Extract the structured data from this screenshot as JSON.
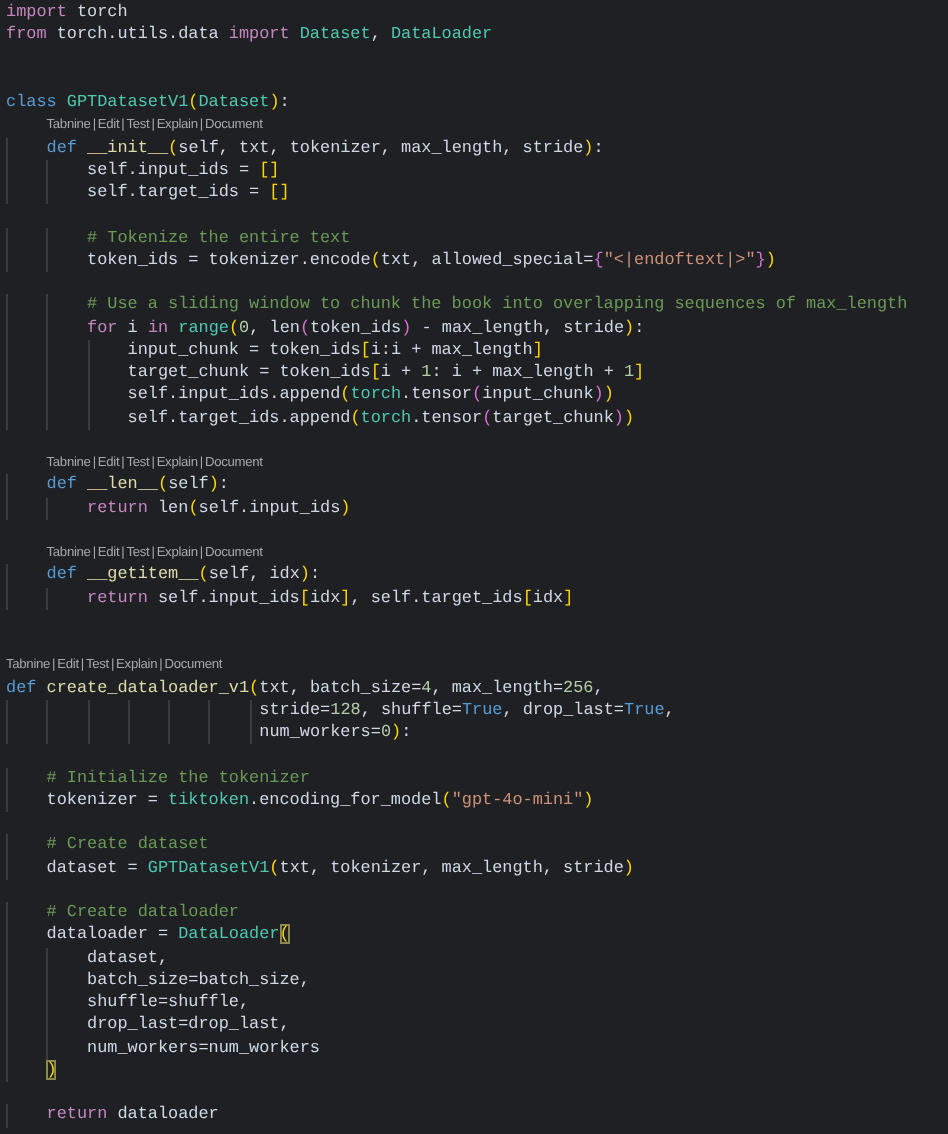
{
  "editor": {
    "lens_separator": "|",
    "lines": [
      {
        "kind": "code",
        "tokens": [
          {
            "kind": "keyword",
            "text": "import"
          },
          {
            "kind": "plain",
            "text": " torch"
          }
        ]
      },
      {
        "kind": "code",
        "tokens": [
          {
            "kind": "keyword",
            "text": "from"
          },
          {
            "kind": "plain",
            "text": " torch.utils.data "
          },
          {
            "kind": "keyword",
            "text": "import"
          },
          {
            "kind": "class",
            "text": " Dataset"
          },
          {
            "kind": "plain",
            "text": ", "
          },
          {
            "kind": "class",
            "text": "DataLoader"
          }
        ]
      },
      {
        "kind": "blank"
      },
      {
        "kind": "blank"
      },
      {
        "kind": "code",
        "tokens": [
          {
            "kind": "storage",
            "text": "class"
          },
          {
            "kind": "class",
            "text": " GPTDatasetV1"
          },
          {
            "kind": "bracket",
            "text": "("
          },
          {
            "kind": "class",
            "text": "Dataset"
          },
          {
            "kind": "bracket",
            "text": ")"
          },
          {
            "kind": "plain",
            "text": ":"
          }
        ]
      },
      {
        "kind": "lens",
        "items": [
          "Tabnine",
          "Edit",
          "Test",
          "Explain",
          "Document"
        ]
      },
      {
        "kind": "code",
        "tokens": [
          {
            "kind": "storage",
            "text": "    def"
          },
          {
            "kind": "function",
            "text": " __init__"
          },
          {
            "kind": "bracket",
            "text": "("
          },
          {
            "kind": "plain",
            "text": "self, txt, tokenizer, max_length, stride"
          },
          {
            "kind": "bracket",
            "text": ")"
          },
          {
            "kind": "plain",
            "text": ":"
          }
        ]
      },
      {
        "kind": "code",
        "tokens": [
          {
            "kind": "plain",
            "text": "        self.input_ids = "
          },
          {
            "kind": "bracket",
            "text": "[]"
          }
        ]
      },
      {
        "kind": "code",
        "tokens": [
          {
            "kind": "plain",
            "text": "        self.target_ids = "
          },
          {
            "kind": "bracket",
            "text": "[]"
          }
        ]
      },
      {
        "kind": "blank"
      },
      {
        "kind": "code",
        "tokens": [
          {
            "kind": "comment",
            "text": "        # Tokenize the entire text"
          }
        ]
      },
      {
        "kind": "code",
        "tokens": [
          {
            "kind": "plain",
            "text": "        token_ids = tokenizer.encode"
          },
          {
            "kind": "bracket",
            "text": "("
          },
          {
            "kind": "plain",
            "text": "txt, allowed_special="
          },
          {
            "kind": "bracket2",
            "text": "{"
          },
          {
            "kind": "string",
            "text": "\"<|endoftext|>\""
          },
          {
            "kind": "bracket2",
            "text": "}"
          },
          {
            "kind": "bracket",
            "text": ")"
          }
        ]
      },
      {
        "kind": "blank"
      },
      {
        "kind": "code",
        "tokens": [
          {
            "kind": "comment",
            "text": "        # Use a sliding window to chunk the book into overlapping sequences of max_length"
          }
        ]
      },
      {
        "kind": "code",
        "tokens": [
          {
            "kind": "keyword",
            "text": "        for"
          },
          {
            "kind": "plain",
            "text": " i "
          },
          {
            "kind": "keyword",
            "text": "in"
          },
          {
            "kind": "class",
            "text": " range"
          },
          {
            "kind": "bracket",
            "text": "("
          },
          {
            "kind": "number",
            "text": "0"
          },
          {
            "kind": "plain",
            "text": ", len"
          },
          {
            "kind": "bracket2",
            "text": "("
          },
          {
            "kind": "plain",
            "text": "token_ids"
          },
          {
            "kind": "bracket2",
            "text": ")"
          },
          {
            "kind": "plain",
            "text": " - max_length, stride"
          },
          {
            "kind": "bracket",
            "text": ")"
          },
          {
            "kind": "plain",
            "text": ":"
          }
        ]
      },
      {
        "kind": "code",
        "tokens": [
          {
            "kind": "plain",
            "text": "            input_chunk = token_ids"
          },
          {
            "kind": "bracket",
            "text": "["
          },
          {
            "kind": "plain",
            "text": "i:i + max_length"
          },
          {
            "kind": "bracket",
            "text": "]"
          }
        ]
      },
      {
        "kind": "code",
        "tokens": [
          {
            "kind": "plain",
            "text": "            target_chunk = token_ids"
          },
          {
            "kind": "bracket",
            "text": "["
          },
          {
            "kind": "plain",
            "text": "i + "
          },
          {
            "kind": "number",
            "text": "1"
          },
          {
            "kind": "plain",
            "text": ": i + max_length + "
          },
          {
            "kind": "number",
            "text": "1"
          },
          {
            "kind": "bracket",
            "text": "]"
          }
        ]
      },
      {
        "kind": "code",
        "tokens": [
          {
            "kind": "plain",
            "text": "            self.input_ids.append"
          },
          {
            "kind": "bracket",
            "text": "("
          },
          {
            "kind": "class",
            "text": "torch"
          },
          {
            "kind": "plain",
            "text": ".tensor"
          },
          {
            "kind": "bracket2",
            "text": "("
          },
          {
            "kind": "plain",
            "text": "input_chunk"
          },
          {
            "kind": "bracket2",
            "text": ")"
          },
          {
            "kind": "bracket",
            "text": ")"
          }
        ]
      },
      {
        "kind": "code",
        "tokens": [
          {
            "kind": "plain",
            "text": "            self.target_ids.append"
          },
          {
            "kind": "bracket",
            "text": "("
          },
          {
            "kind": "class",
            "text": "torch"
          },
          {
            "kind": "plain",
            "text": ".tensor"
          },
          {
            "kind": "bracket2",
            "text": "("
          },
          {
            "kind": "plain",
            "text": "target_chunk"
          },
          {
            "kind": "bracket2",
            "text": ")"
          },
          {
            "kind": "bracket",
            "text": ")"
          }
        ]
      },
      {
        "kind": "blank"
      },
      {
        "kind": "lens",
        "items": [
          "Tabnine",
          "Edit",
          "Test",
          "Explain",
          "Document"
        ]
      },
      {
        "kind": "code",
        "tokens": [
          {
            "kind": "storage",
            "text": "    def"
          },
          {
            "kind": "function",
            "text": " __len__"
          },
          {
            "kind": "bracket",
            "text": "("
          },
          {
            "kind": "plain",
            "text": "self"
          },
          {
            "kind": "bracket",
            "text": ")"
          },
          {
            "kind": "plain",
            "text": ":"
          }
        ]
      },
      {
        "kind": "code",
        "tokens": [
          {
            "kind": "keyword",
            "text": "        return"
          },
          {
            "kind": "plain",
            "text": " len"
          },
          {
            "kind": "bracket",
            "text": "("
          },
          {
            "kind": "plain",
            "text": "self.input_ids"
          },
          {
            "kind": "bracket",
            "text": ")"
          }
        ]
      },
      {
        "kind": "blank"
      },
      {
        "kind": "lens",
        "items": [
          "Tabnine",
          "Edit",
          "Test",
          "Explain",
          "Document"
        ]
      },
      {
        "kind": "code",
        "tokens": [
          {
            "kind": "storage",
            "text": "    def"
          },
          {
            "kind": "function",
            "text": " __getitem__"
          },
          {
            "kind": "bracket",
            "text": "("
          },
          {
            "kind": "plain",
            "text": "self, idx"
          },
          {
            "kind": "bracket",
            "text": ")"
          },
          {
            "kind": "plain",
            "text": ":"
          }
        ]
      },
      {
        "kind": "code",
        "tokens": [
          {
            "kind": "keyword",
            "text": "        return"
          },
          {
            "kind": "plain",
            "text": " self.input_ids"
          },
          {
            "kind": "bracket",
            "text": "["
          },
          {
            "kind": "plain",
            "text": "idx"
          },
          {
            "kind": "bracket",
            "text": "]"
          },
          {
            "kind": "plain",
            "text": ", self.target_ids"
          },
          {
            "kind": "bracket",
            "text": "["
          },
          {
            "kind": "plain",
            "text": "idx"
          },
          {
            "kind": "bracket",
            "text": "]"
          }
        ]
      },
      {
        "kind": "blank"
      },
      {
        "kind": "blank"
      },
      {
        "kind": "lens",
        "items": [
          "Tabnine",
          "Edit",
          "Test",
          "Explain",
          "Document"
        ]
      },
      {
        "kind": "code",
        "tokens": [
          {
            "kind": "storage",
            "text": "def"
          },
          {
            "kind": "function",
            "text": " create_dataloader_v1"
          },
          {
            "kind": "bracket",
            "text": "("
          },
          {
            "kind": "plain",
            "text": "txt, batch_size="
          },
          {
            "kind": "number",
            "text": "4"
          },
          {
            "kind": "plain",
            "text": ", max_length="
          },
          {
            "kind": "number",
            "text": "256"
          },
          {
            "kind": "plain",
            "text": ","
          }
        ]
      },
      {
        "kind": "code",
        "tokens": [
          {
            "kind": "plain",
            "text": "                         stride="
          },
          {
            "kind": "number",
            "text": "128"
          },
          {
            "kind": "plain",
            "text": ", shuffle="
          },
          {
            "kind": "storage",
            "text": "True"
          },
          {
            "kind": "plain",
            "text": ", drop_last="
          },
          {
            "kind": "storage",
            "text": "True"
          },
          {
            "kind": "plain",
            "text": ","
          }
        ]
      },
      {
        "kind": "code",
        "tokens": [
          {
            "kind": "plain",
            "text": "                         num_workers="
          },
          {
            "kind": "number",
            "text": "0"
          },
          {
            "kind": "bracket",
            "text": ")"
          },
          {
            "kind": "plain",
            "text": ":"
          }
        ]
      },
      {
        "kind": "blank"
      },
      {
        "kind": "code",
        "tokens": [
          {
            "kind": "comment",
            "text": "    # Initialize the tokenizer"
          }
        ]
      },
      {
        "kind": "code",
        "tokens": [
          {
            "kind": "plain",
            "text": "    tokenizer = "
          },
          {
            "kind": "class",
            "text": "tiktoken"
          },
          {
            "kind": "plain",
            "text": ".encoding_for_model"
          },
          {
            "kind": "bracket",
            "text": "("
          },
          {
            "kind": "string",
            "text": "\"gpt-4o-mini\""
          },
          {
            "kind": "bracket",
            "text": ")"
          }
        ]
      },
      {
        "kind": "blank"
      },
      {
        "kind": "code",
        "tokens": [
          {
            "kind": "comment",
            "text": "    # Create dataset"
          }
        ]
      },
      {
        "kind": "code",
        "tokens": [
          {
            "kind": "plain",
            "text": "    dataset = "
          },
          {
            "kind": "class",
            "text": "GPTDatasetV1"
          },
          {
            "kind": "bracket",
            "text": "("
          },
          {
            "kind": "plain",
            "text": "txt, tokenizer, max_length, stride"
          },
          {
            "kind": "bracket",
            "text": ")"
          }
        ]
      },
      {
        "kind": "blank"
      },
      {
        "kind": "code",
        "tokens": [
          {
            "kind": "comment",
            "text": "    # Create dataloader"
          }
        ]
      },
      {
        "kind": "code",
        "tokens": [
          {
            "kind": "plain",
            "text": "    dataloader = "
          },
          {
            "kind": "class",
            "text": "DataLoader"
          },
          {
            "kind": "match",
            "text": "("
          }
        ]
      },
      {
        "kind": "code",
        "tokens": [
          {
            "kind": "plain",
            "text": "        dataset,"
          }
        ]
      },
      {
        "kind": "code",
        "tokens": [
          {
            "kind": "plain",
            "text": "        batch_size=batch_size,"
          }
        ]
      },
      {
        "kind": "code",
        "tokens": [
          {
            "kind": "plain",
            "text": "        shuffle=shuffle,"
          }
        ]
      },
      {
        "kind": "code",
        "tokens": [
          {
            "kind": "plain",
            "text": "        drop_last=drop_last,"
          }
        ]
      },
      {
        "kind": "code",
        "tokens": [
          {
            "kind": "plain",
            "text": "        num_workers=num_workers"
          }
        ]
      },
      {
        "kind": "code",
        "tokens": [
          {
            "kind": "match",
            "text": "    )"
          }
        ]
      },
      {
        "kind": "blank"
      },
      {
        "kind": "code",
        "tokens": [
          {
            "kind": "keyword",
            "text": "    return"
          },
          {
            "kind": "plain",
            "text": " dataloader"
          }
        ]
      }
    ]
  }
}
